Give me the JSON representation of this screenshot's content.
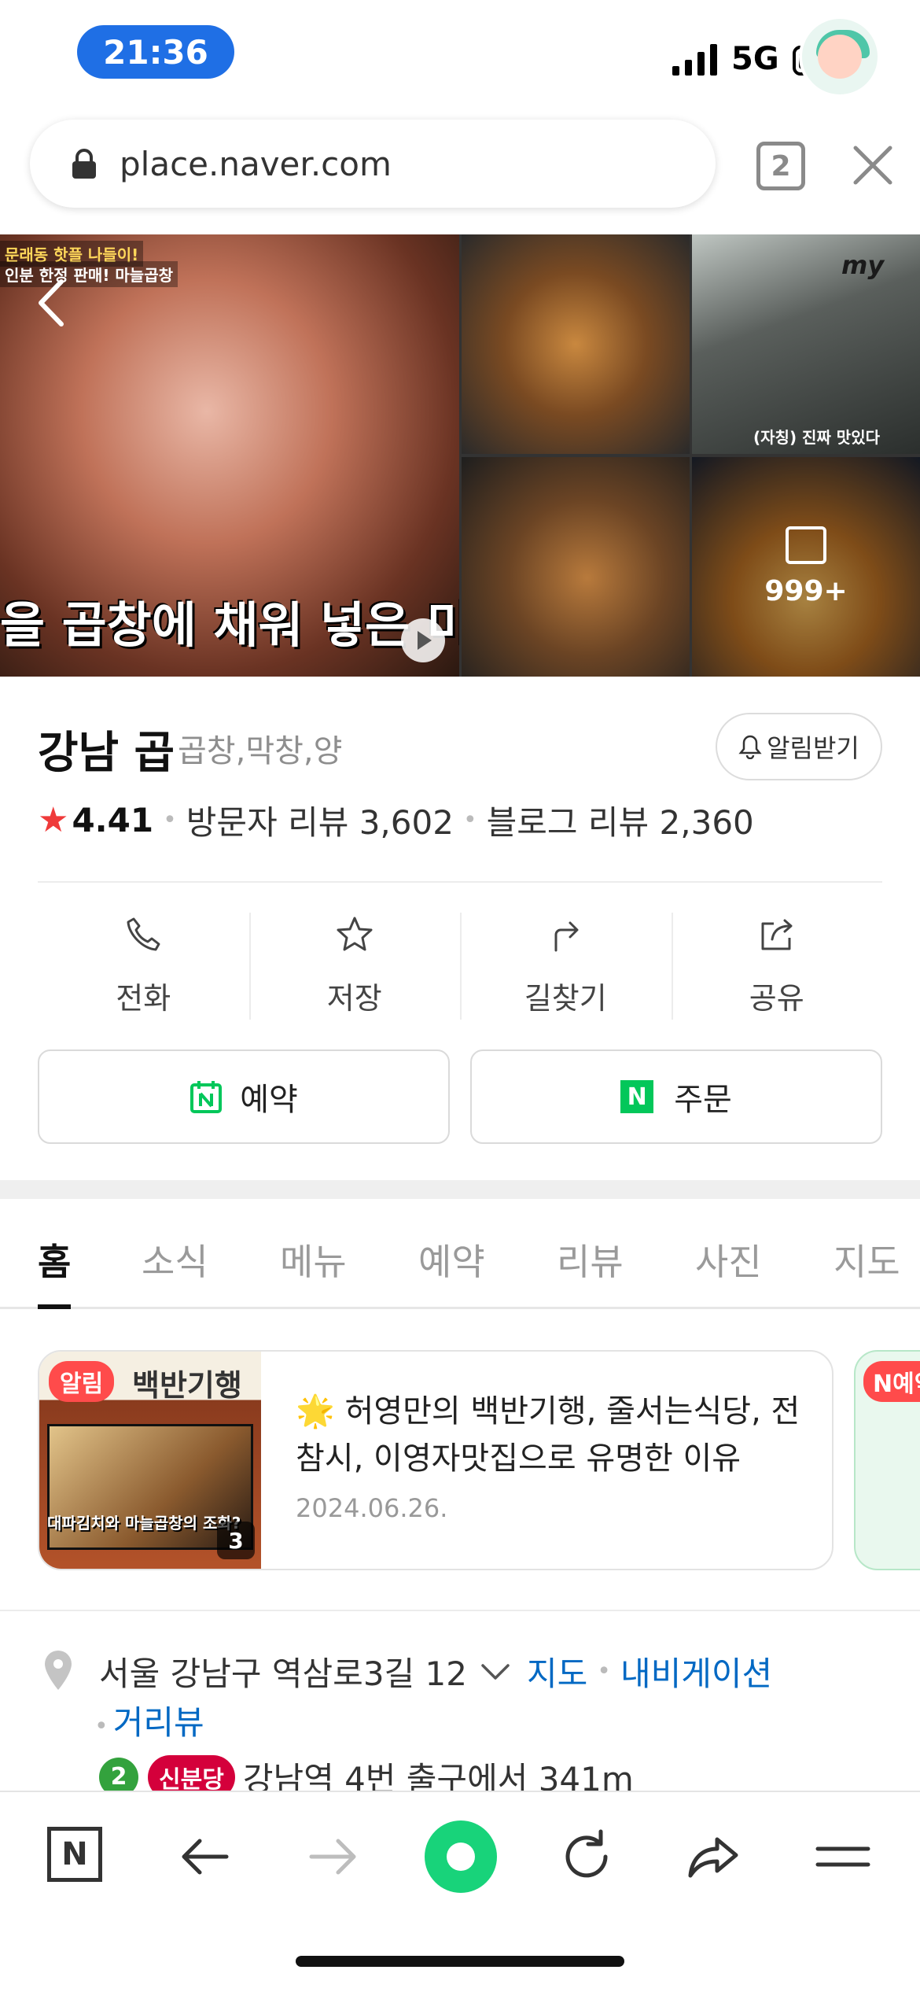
{
  "status_bar": {
    "time": "21:36",
    "network": "5G"
  },
  "browser": {
    "url": "place.naver.com",
    "tab_count": "2"
  },
  "photos": {
    "main_caption": "을 곱창에 채워 넣은 미",
    "main_banner_1": "문래동 핫플 나들이!",
    "main_banner_2": "인분 한정 판매! 마늘곱창",
    "tile2_caption": "(자칭) 진짜 맛있다",
    "my_label": "my",
    "more_count": "999+"
  },
  "place": {
    "name": "강남 곱",
    "category": "곱창,막창,양",
    "notify_label": "알림받기",
    "rating": "4.41",
    "visitor_reviews": "방문자 리뷰 3,602",
    "blog_reviews": "블로그 리뷰 2,360"
  },
  "actions": {
    "call": "전화",
    "save": "저장",
    "directions": "길찾기",
    "share": "공유"
  },
  "booking": {
    "reserve": "예약",
    "order": "주문"
  },
  "tabs": [
    "홈",
    "소식",
    "메뉴",
    "예약",
    "리뷰",
    "사진",
    "지도"
  ],
  "news": {
    "badge": "알림",
    "thumb_title": "백반기행",
    "thumb_caption": "대파김치와 마늘곱창의 조화?",
    "thumb_count": "3",
    "title": "🌟 허영만의 백반기행, 줄서는식당, 전참시, 이영자맛집으로 유명한 이유",
    "date": "2024.06.26.",
    "next_badge": "N예약"
  },
  "address": {
    "text": "서울 강남구 역삼로3길 12",
    "map_link": "지도",
    "nav_link": "내비게이션",
    "street_view": "거리뷰",
    "subway_line": "2",
    "subway_line2": "신분당",
    "subway_text": "강남역 4번 출구에서 341m"
  },
  "colors": {
    "naver_green": "#03c75a",
    "link_blue": "#0068c3",
    "star_red": "#ef3a3a",
    "time_pill": "#1f6fe5"
  }
}
